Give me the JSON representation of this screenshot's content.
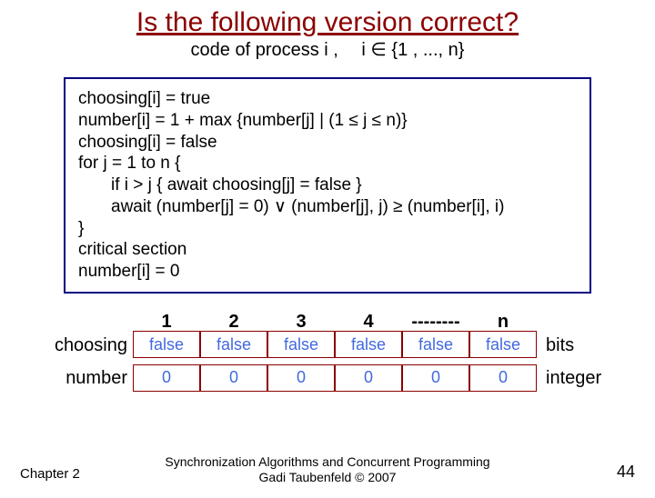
{
  "title": "Is the following version correct?",
  "subtitle": "code of process i ,  i ∈ {1 , ..., n}",
  "code": {
    "l1": "choosing[i] = true",
    "l2": "number[i] = 1 + max {number[j] | (1 ≤ j ≤ n)}",
    "l3": "choosing[i] = false",
    "l4": "for j = 1 to n {",
    "l5": "if i > j { await choosing[j] = false }",
    "l6": "await (number[j] = 0) ∨ (number[j], j) ≥ (number[i], i)",
    "l7": "}",
    "l8": "critical section",
    "l9": "number[i] = 0"
  },
  "headers": [
    "1",
    "2",
    "3",
    "4",
    "--------",
    "n"
  ],
  "rows": {
    "choosing": {
      "label": "choosing",
      "cells": [
        "false",
        "false",
        "false",
        "false",
        "false",
        "false"
      ],
      "type": "bits"
    },
    "number": {
      "label": "number",
      "cells": [
        "0",
        "0",
        "0",
        "0",
        "0",
        "0"
      ],
      "type": "integer"
    }
  },
  "footer": {
    "chapter": "Chapter 2",
    "credit_line1": "Synchronization Algorithms and Concurrent Programming",
    "credit_line2": "Gadi Taubenfeld © 2007",
    "page": "44"
  }
}
